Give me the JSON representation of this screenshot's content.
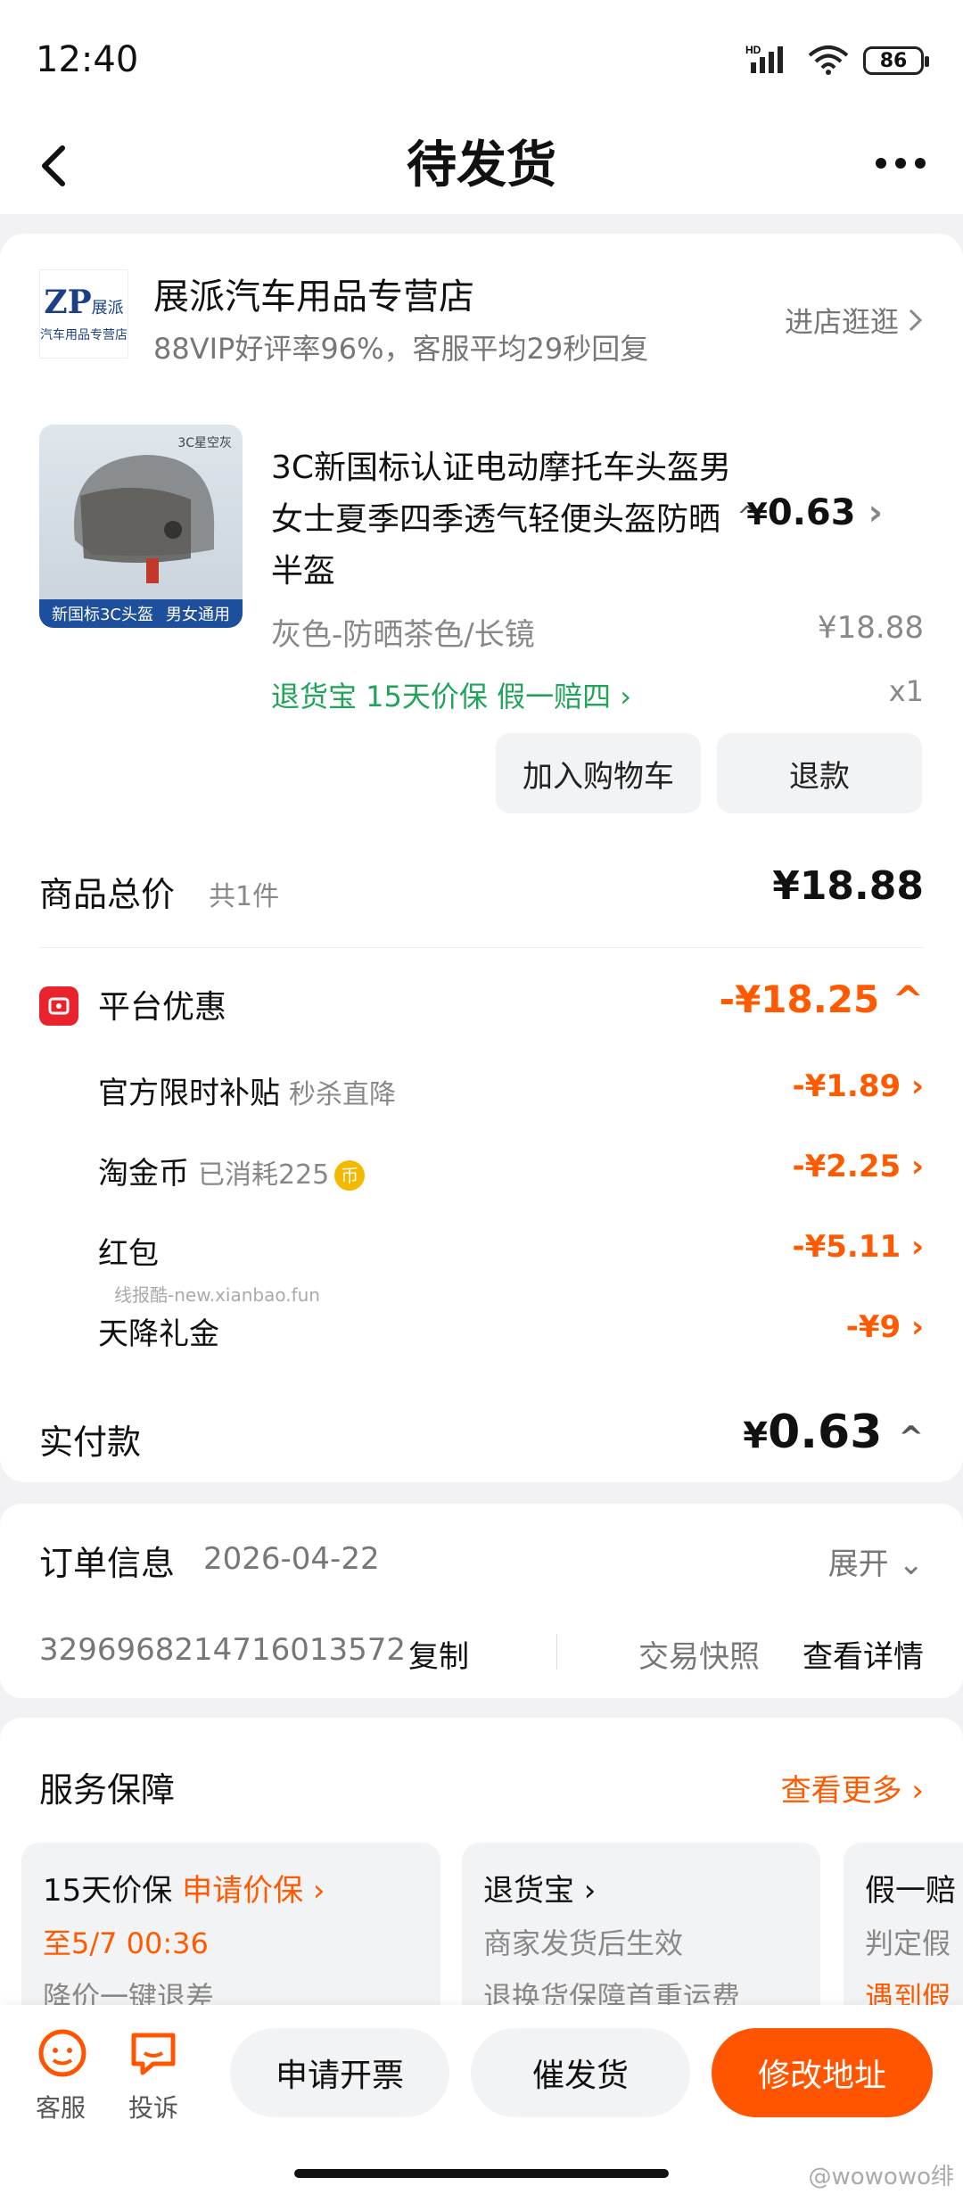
{
  "status": {
    "time": "12:40",
    "battery": "86",
    "network": "HD"
  },
  "nav": {
    "title": "待发货"
  },
  "shop": {
    "logo_text": "ZP",
    "logo_cn": "展派",
    "logo_sub": "汽车用品专营店",
    "name": "展派汽车用品专营店",
    "subtitle": "88VIP好评率96%，客服平均29秒回复",
    "enter": "进店逛逛"
  },
  "product": {
    "image_tag": "3C星空灰",
    "image_banner": [
      "新国标3C头盔",
      "男女通用"
    ],
    "title": "3C新国标认证电动摩托车头盔男女士夏季四季透气轻便头盔防晒半盔",
    "price_symbol": "¥",
    "price": "0.63",
    "spec": "灰色-防晒茶色/长镜",
    "original_price": "¥18.88",
    "services": "退货宝  15天价保  假一赔四 ›",
    "quantity": "x1",
    "add_cart": "加入购物车",
    "refund": "退款"
  },
  "totals": {
    "goods_label": "商品总价",
    "goods_count": "共1件",
    "goods_value": "¥18.88",
    "platform_label": "平台优惠",
    "platform_value": "-¥18.25",
    "discounts": [
      {
        "label": "官方限时补贴",
        "sub": "秒杀直降",
        "value": "-¥1.89"
      },
      {
        "label": "淘金币",
        "sub": "已消耗225",
        "value": "-¥2.25"
      },
      {
        "label": "红包",
        "sub": "",
        "value": "-¥5.11"
      },
      {
        "label": "天降礼金",
        "sub": "",
        "value": "-¥9"
      }
    ],
    "watermark": "线报酷-new.xianbao.fun",
    "paid_label": "实付款",
    "paid_symbol": "¥",
    "paid_value": "0.63"
  },
  "order": {
    "label": "订单信息",
    "date": "2026-04-22",
    "expand": "展开",
    "number": "3296968214716013572",
    "copy": "复制",
    "snapshot": "交易快照",
    "detail": "查看详情"
  },
  "service": {
    "title": "服务保障",
    "more": "查看更多 ›",
    "cards": [
      {
        "title": "15天价保",
        "action": "申请价保 ›",
        "line2": "至5/7 00:36",
        "line3": "降价一键退差"
      },
      {
        "title": "退货宝 ›",
        "line2": "商家发货后生效",
        "line3": "退换货保障首重运费"
      },
      {
        "title": "假一赔",
        "line2": "判定假",
        "line3": "遇到假"
      }
    ]
  },
  "bottom": {
    "cs": "客服",
    "complain": "投诉",
    "invoice": "申请开票",
    "urge": "催发货",
    "address": "修改地址"
  },
  "credit": "@wowowo绯",
  "colors": {
    "accent": "#ff5500",
    "green": "#22a35a",
    "red": "#e8232e"
  }
}
